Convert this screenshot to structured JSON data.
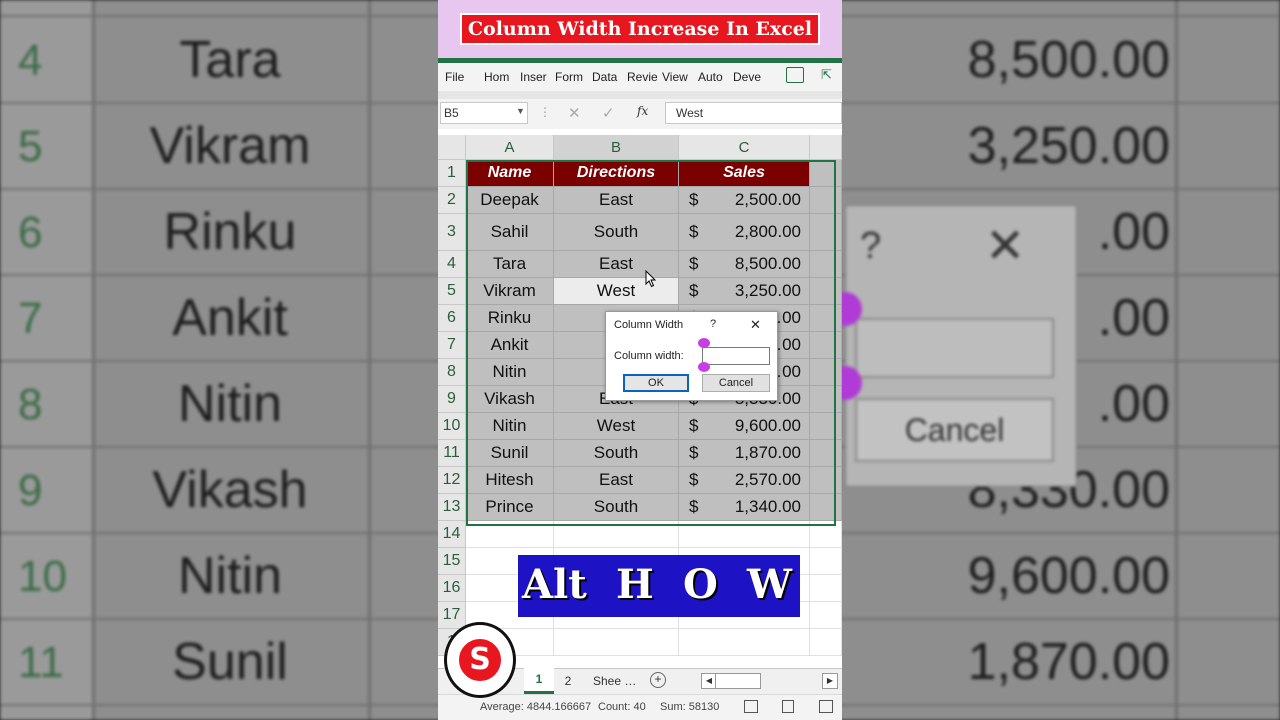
{
  "title_banner": "Column Width Increase In Excel",
  "ribbon_tabs": [
    "File",
    "Hom",
    "Inser",
    "Form",
    "Data",
    "Revie",
    "View",
    "Auto",
    "Deve"
  ],
  "name_box": "B5",
  "formula_value": "West",
  "fx_label": "fx",
  "column_headers": [
    "A",
    "B",
    "C"
  ],
  "table_headers": {
    "name": "Name",
    "directions": "Directions",
    "sales": "Sales"
  },
  "currency": "$",
  "rows": [
    {
      "num": "2",
      "name": "Deepak",
      "dir": "East",
      "amt": "2,500.00"
    },
    {
      "num": "3",
      "name": "Sahil",
      "dir": "South",
      "amt": "2,800.00"
    },
    {
      "num": "4",
      "name": "Tara",
      "dir": "East",
      "amt": "8,500.00"
    },
    {
      "num": "5",
      "name": "Vikram",
      "dir": "West",
      "amt": "3,250.00"
    },
    {
      "num": "6",
      "name": "Rinku",
      "dir": "So",
      "amt": "…00"
    },
    {
      "num": "7",
      "name": "Ankit",
      "dir": "E",
      "amt": "…00"
    },
    {
      "num": "8",
      "name": "Nitin",
      "dir": "So",
      "amt": "…00"
    },
    {
      "num": "9",
      "name": "Vikash",
      "dir": "East",
      "amt": "8,330.00"
    },
    {
      "num": "10",
      "name": "Nitin",
      "dir": "West",
      "amt": "9,600.00"
    },
    {
      "num": "11",
      "name": "Sunil",
      "dir": "South",
      "amt": "1,870.00"
    },
    {
      "num": "12",
      "name": "Hitesh",
      "dir": "East",
      "amt": "2,570.00"
    },
    {
      "num": "13",
      "name": "Prince",
      "dir": "South",
      "amt": "1,340.00"
    }
  ],
  "empty_rows": [
    "14",
    "15",
    "16",
    "17",
    "1"
  ],
  "dialog": {
    "title": "Column Width",
    "help": "?",
    "close": "✕",
    "field_label": "Column width:",
    "field_value": "",
    "ok": "OK",
    "cancel": "Cancel"
  },
  "shortcut_keys": [
    "Alt",
    "H",
    "O",
    "W"
  ],
  "sheet_tabs": [
    "1",
    "2",
    "Shee …"
  ],
  "status": {
    "average": "Average: 4844.166667",
    "count": "Count: 40",
    "sum": "Sum: 58130"
  },
  "background": {
    "row_numbers": [
      "4",
      "5",
      "6",
      "7",
      "8",
      "9",
      "10",
      "11"
    ],
    "names": [
      "Tara",
      "Vikram",
      "Rinku",
      "Ankit",
      "Nitin",
      "Vikash",
      "Nitin",
      "Sunil"
    ],
    "amounts": [
      "8,500.00",
      "3,250.00",
      ".00",
      ".00",
      ".00",
      "8,330.00",
      "9,600.00",
      "1,870.00"
    ],
    "dialog_help": "?",
    "dialog_close": "✕",
    "dialog_cancel": "Cancel"
  },
  "colors": {
    "accent_green": "#217346",
    "header_fill": "#7b0000",
    "title_red": "#e8161e",
    "keys_blue": "#1d13c4",
    "title_bg": "#e7c6f0"
  }
}
